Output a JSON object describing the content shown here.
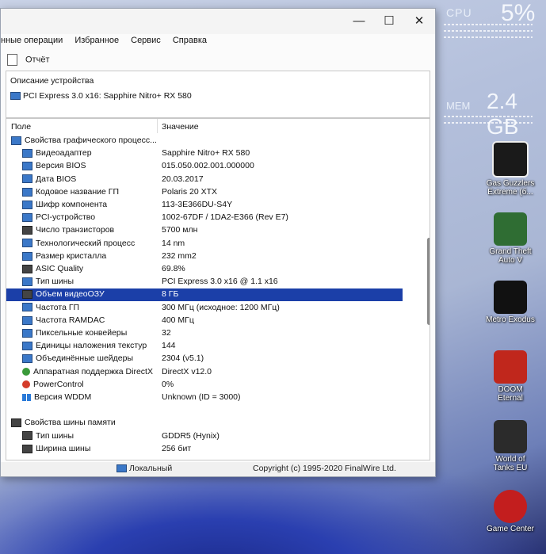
{
  "window": {
    "menu": [
      "нные операции",
      "Избранное",
      "Сервис",
      "Справка"
    ],
    "toolbar_report": "Отчёт",
    "device_description_label": "Описание устройства",
    "device_description_value": "PCI Express 3.0 x16: Sapphire Nitro+ RX 580",
    "table_headers": {
      "field": "Поле",
      "value": "Значение"
    },
    "rows": [
      {
        "name": "Свойства графического процесс...",
        "value": "",
        "indent": 0,
        "icon": "monitor-icon"
      },
      {
        "name": "Видеоадаптер",
        "value": "Sapphire Nitro+ RX 580",
        "indent": 1,
        "icon": "monitor-icon"
      },
      {
        "name": "Версия BIOS",
        "value": "015.050.002.001.000000",
        "indent": 1,
        "icon": "monitor-icon"
      },
      {
        "name": "Дата BIOS",
        "value": "20.03.2017",
        "indent": 1,
        "icon": "monitor-icon"
      },
      {
        "name": "Кодовое название ГП",
        "value": "Polaris 20 XTX",
        "indent": 1,
        "icon": "monitor-icon"
      },
      {
        "name": "Шифр компонента",
        "value": "113-3E366DU-S4Y",
        "indent": 1,
        "icon": "monitor-icon"
      },
      {
        "name": "PCI-устройство",
        "value": "1002-67DF / 1DA2-E366  (Rev E7)",
        "indent": 1,
        "icon": "monitor-icon"
      },
      {
        "name": "Число транзисторов",
        "value": "5700 млн",
        "indent": 1,
        "icon": "chip-icon"
      },
      {
        "name": "Технологический процесс",
        "value": "14 nm",
        "indent": 1,
        "icon": "monitor-icon"
      },
      {
        "name": "Размер кристалла",
        "value": "232 mm2",
        "indent": 1,
        "icon": "monitor-icon"
      },
      {
        "name": "ASIC Quality",
        "value": "69.8%",
        "indent": 1,
        "icon": "chip-icon"
      },
      {
        "name": "Тип шины",
        "value": "PCI Express 3.0 x16 @ 1.1 x16",
        "indent": 1,
        "icon": "monitor-icon"
      },
      {
        "name": "Объем видеоОЗУ",
        "value": "8 ГБ",
        "indent": 1,
        "icon": "memory-icon",
        "selected": true
      },
      {
        "name": "Частота ГП",
        "value": "300 МГц  (исходное: 1200 МГц)",
        "indent": 1,
        "icon": "monitor-icon"
      },
      {
        "name": "Частота RAMDAC",
        "value": "400 МГц",
        "indent": 1,
        "icon": "monitor-icon"
      },
      {
        "name": "Пиксельные конвейеры",
        "value": "32",
        "indent": 1,
        "icon": "monitor-icon"
      },
      {
        "name": "Единицы наложения текстур",
        "value": "144",
        "indent": 1,
        "icon": "monitor-icon"
      },
      {
        "name": "Объединённые шейдеры",
        "value": "2304  (v5.1)",
        "indent": 1,
        "icon": "monitor-icon"
      },
      {
        "name": "Аппаратная поддержка DirectX",
        "value": "DirectX v12.0",
        "indent": 1,
        "icon": "xbox-icon"
      },
      {
        "name": "PowerControl",
        "value": "0%",
        "indent": 1,
        "icon": "power-icon"
      },
      {
        "name": "Версия WDDM",
        "value": "Unknown (ID = 3000)",
        "indent": 1,
        "icon": "windows-icon"
      },
      {
        "name": "",
        "value": "",
        "indent": 0,
        "icon": ""
      },
      {
        "name": "Свойства шины памяти",
        "value": "",
        "indent": 0,
        "icon": "memory-icon"
      },
      {
        "name": "Тип шины",
        "value": "GDDR5 (Hynix)",
        "indent": 1,
        "icon": "memory-icon"
      },
      {
        "name": "Ширина шины",
        "value": "256 бит",
        "indent": 1,
        "icon": "memory-icon"
      }
    ],
    "status_left": "Локальный",
    "status_right": "Copyright (c) 1995-2020 FinalWire Ltd."
  },
  "gadget": {
    "cpu_label": "CPU",
    "cpu_value": "5%",
    "mem_label": "МЕМ",
    "mem_value": "2.4 GB"
  },
  "desktop_icons": [
    {
      "label": "Gas Guzzlers Extreme (б...",
      "color": "#1a1a1a"
    },
    {
      "label": "Grand Theft Auto V",
      "color": "#2f6d33"
    },
    {
      "label": "Metro Exodus",
      "color": "#111111"
    },
    {
      "label": "DOOM Eternal",
      "color": "#c0271c"
    },
    {
      "label": "World of Tanks EU",
      "color": "#2b2b2b"
    },
    {
      "label": "Game Center",
      "color": "#c31e1e"
    }
  ]
}
